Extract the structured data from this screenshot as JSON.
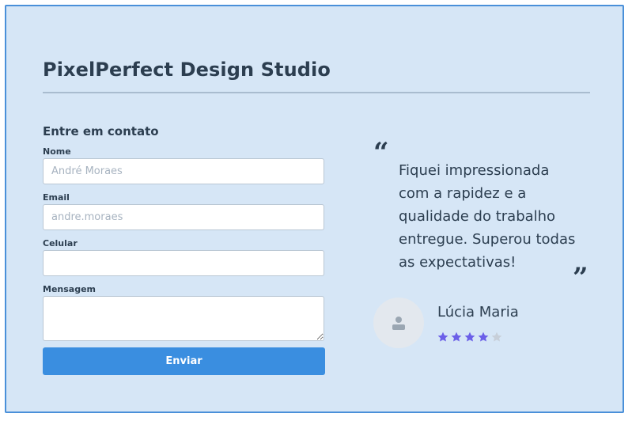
{
  "header": {
    "title": "PixelPerfect Design Studio"
  },
  "contact_form": {
    "heading": "Entre em contato",
    "fields": [
      {
        "label": "Nome",
        "placeholder": "André Moraes"
      },
      {
        "label": "Email",
        "placeholder": "andre.moraes"
      },
      {
        "label": "Celular",
        "placeholder": ""
      },
      {
        "label": "Mensagem",
        "placeholder": ""
      }
    ],
    "submit_label": "Enviar"
  },
  "testimonial": {
    "open_quote": "“",
    "quote": "Fiquei impressionada com a rapidez e a qualidade do trabalho entregue. Superou todas as expectativas!",
    "close_quote": "”",
    "author": "Lúcia Maria",
    "rating": 4,
    "rating_max": 5,
    "avatar_icon": "user-icon"
  },
  "colors": {
    "background": "#d6e6f6",
    "border": "#4a90d9",
    "button": "#3a8ee0",
    "star_filled": "#6b5fe8",
    "star_empty": "#c7cfd9"
  }
}
